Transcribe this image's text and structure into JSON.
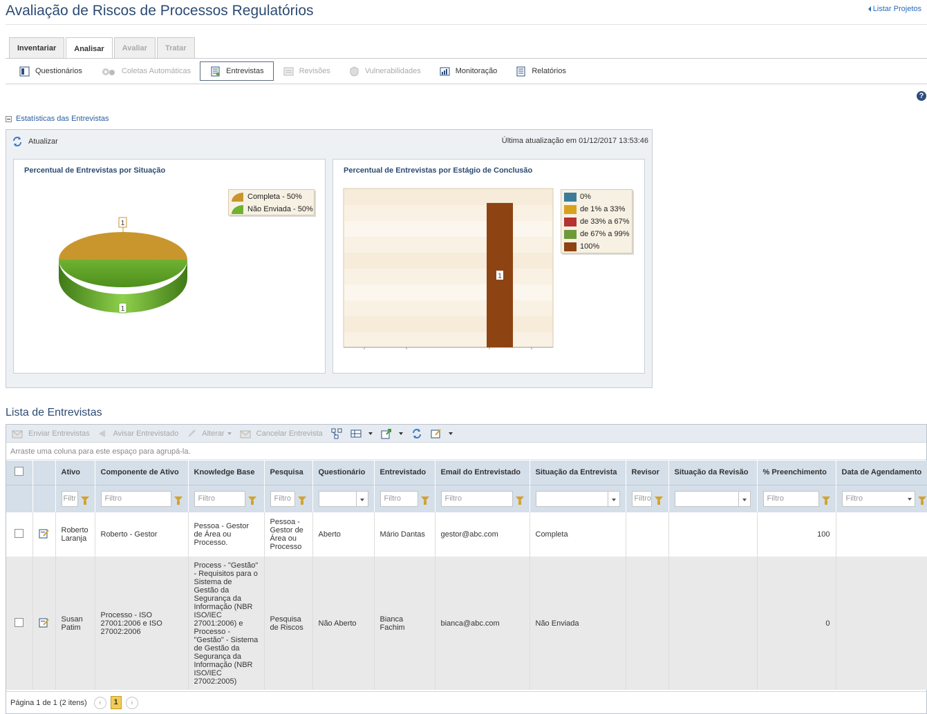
{
  "header": {
    "title": "Avaliação de Riscos de Processos Regulatórios",
    "list_projects": "Listar Projetos"
  },
  "tabs": [
    {
      "label": "Inventariar"
    },
    {
      "label": "Analisar"
    },
    {
      "label": "Avaliar"
    },
    {
      "label": "Tratar"
    }
  ],
  "subnav": [
    {
      "label": "Questionários"
    },
    {
      "label": "Coletas Automáticas"
    },
    {
      "label": "Entrevistas"
    },
    {
      "label": "Revisões"
    },
    {
      "label": "Vulnerabilidades"
    },
    {
      "label": "Monitoração"
    },
    {
      "label": "Relatórios"
    }
  ],
  "stats": {
    "section_label": "Estatísticas das Entrevistas",
    "refresh_label": "Atualizar",
    "last_update": "Última atualização em 01/12/2017 13:53:46"
  },
  "chart_data": [
    {
      "type": "pie",
      "title": "Percentual de Entrevistas por Situação",
      "labels": [
        "Completa",
        "Não Enviada"
      ],
      "values": [
        1,
        1
      ],
      "percents": [
        50,
        50
      ],
      "legend": [
        "Completa - 50%",
        "Não Enviada - 50%"
      ],
      "data_labels": [
        "1",
        "1"
      ],
      "colors": [
        "#c9962d",
        "#6fb231"
      ],
      "legend_position": "top-right"
    },
    {
      "type": "bar",
      "title": "Percentual de Entrevistas por Estágio de Conclusão",
      "series": [
        {
          "name": "0%",
          "values": [
            0
          ],
          "color": "#3d7c98"
        },
        {
          "name": "de 1% a 33%",
          "values": [
            0
          ],
          "color": "#d7a21e"
        },
        {
          "name": "de 33% a 67%",
          "values": [
            0
          ],
          "color": "#b73232"
        },
        {
          "name": "de 67% a 99%",
          "values": [
            0
          ],
          "color": "#6e9a39"
        },
        {
          "name": "100%",
          "values": [
            1
          ],
          "color": "#8d4412"
        }
      ],
      "data_labels": [
        "1"
      ],
      "ylim": [
        0,
        1.1
      ],
      "legend_position": "right"
    }
  ],
  "list": {
    "title": "Lista de Entrevistas",
    "toolbar": {
      "send": "Enviar Entrevistas",
      "notify": "Avisar Entrevistado",
      "change": "Alterar",
      "cancel": "Cancelar Entrevista"
    },
    "group_hint": "Arraste uma coluna para este espaço para agrupá-la.",
    "columns": [
      "Ativo",
      "Componente de Ativo",
      "Knowledge Base",
      "Pesquisa",
      "Questionário",
      "Entrevistado",
      "Email do Entrevistado",
      "Situação da Entrevista",
      "Revisor",
      "Situação da Revisão",
      "% Preenchimento",
      "Data de Agendamento"
    ],
    "filter_placeholder": "Filtro",
    "filter_placeholder_short": "Filtr",
    "rows": [
      {
        "ativo": "Roberto Laranja",
        "componente": "Roberto - Gestor",
        "kb": "Pessoa - Gestor de Área ou Processo.",
        "pesquisa": "Pessoa - Gestor de Área ou Processo",
        "questionario": "Aberto",
        "entrevistado": "Mário Dantas",
        "email": "gestor@abc.com",
        "situacao": "Completa",
        "revisor": "",
        "sit_revisao": "",
        "preenchimento": "100",
        "data": ""
      },
      {
        "ativo": "Susan Patim",
        "componente": "Processo - ISO 27001:2006 e ISO 27002:2006",
        "kb": "Process - \"Gestão\" - Requisitos para o Sistema de Gestão da Segurança da Informação (NBR ISO/IEC 27001:2006) e Processo - \"Gestão\" - Sistema de Gestão da Segurança da Informação (NBR ISO/IEC 27002:2005)",
        "pesquisa": "Pesquisa de Riscos",
        "questionario": "Não Aberto",
        "entrevistado": "Bianca Fachim",
        "email": "bianca@abc.com",
        "situacao": "Não Enviada",
        "revisor": "",
        "sit_revisao": "",
        "preenchimento": "0",
        "data": ""
      }
    ],
    "pager": {
      "text": "Página 1 de 1 (2 itens)",
      "current": "1",
      "prev": "‹",
      "next": "›"
    }
  }
}
